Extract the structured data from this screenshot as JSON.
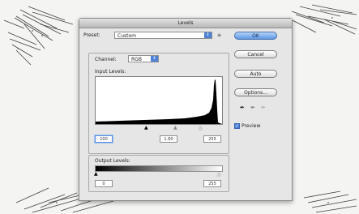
{
  "dialog": {
    "title": "Levels",
    "preset_label": "Preset:",
    "preset_value": "Custom",
    "preset_menu_icon": "menu-icon",
    "channel_label": "Channel:",
    "channel_value": "RGB",
    "input_levels_label": "Input Levels:",
    "input_values": [
      "100",
      "1.60",
      "255"
    ],
    "output_levels_label": "Output Levels:",
    "output_values": [
      "0",
      "255"
    ],
    "buttons": {
      "ok": "OK",
      "cancel": "Cancel",
      "auto": "Auto",
      "options": "Options..."
    },
    "eyedroppers": [
      "black-eyedropper-icon",
      "gray-eyedropper-icon",
      "white-eyedropper-icon"
    ],
    "preview_label": "Preview",
    "preview_checked": true,
    "accent_color": "#4d82d6"
  }
}
